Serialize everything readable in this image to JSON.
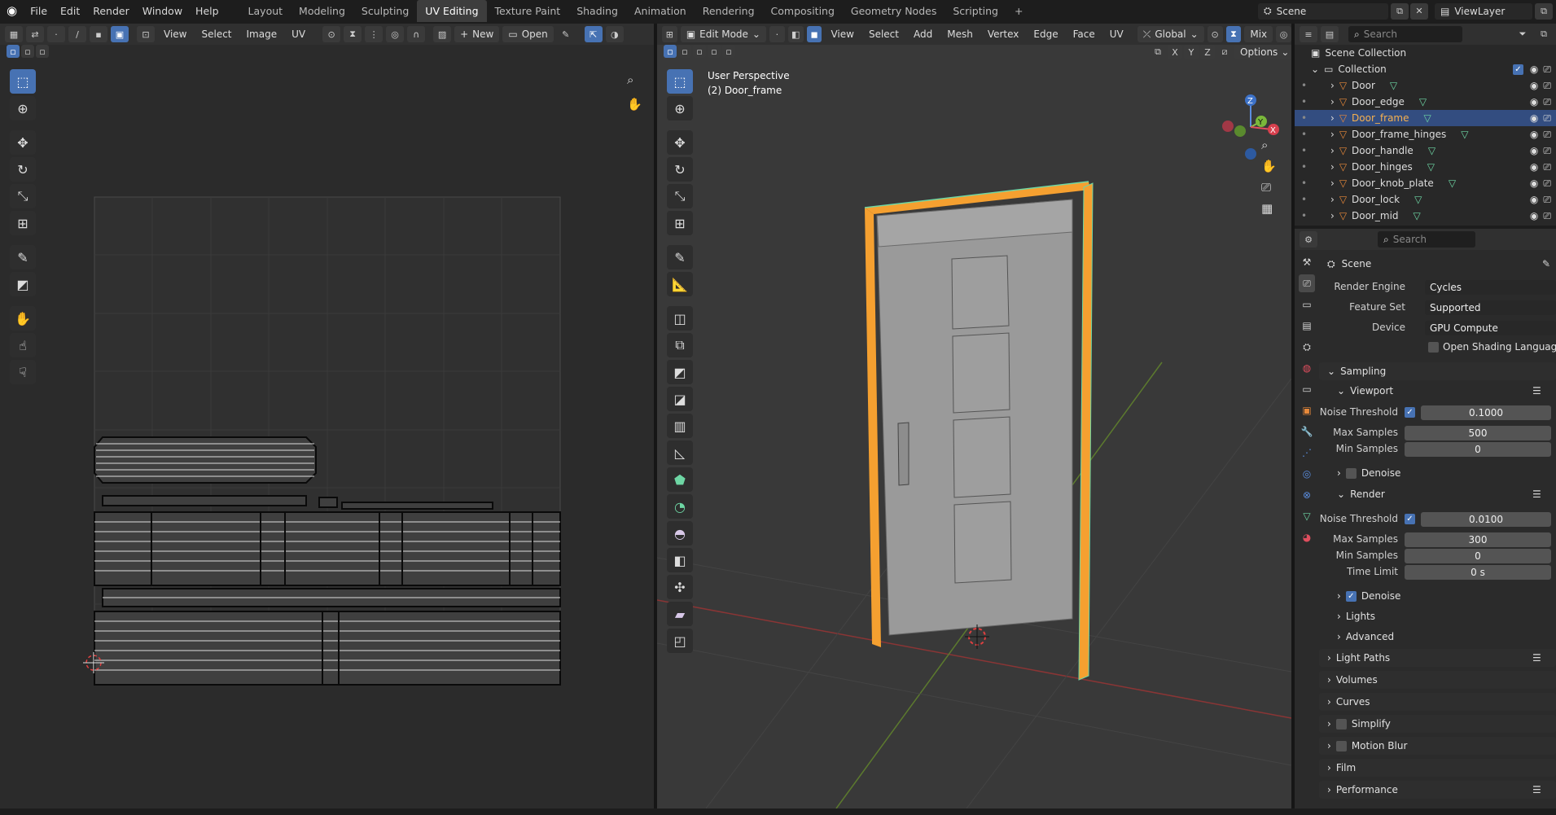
{
  "topbar": {
    "menus": [
      "File",
      "Edit",
      "Render",
      "Window",
      "Help"
    ],
    "tabs": [
      "Layout",
      "Modeling",
      "Sculpting",
      "UV Editing",
      "Texture Paint",
      "Shading",
      "Animation",
      "Rendering",
      "Compositing",
      "Geometry Nodes",
      "Scripting"
    ],
    "active_tab": "UV Editing",
    "add_tab": "+",
    "scene": "Scene",
    "view_layer": "ViewLayer"
  },
  "uv_editor": {
    "menus": [
      "View",
      "Select",
      "Image",
      "UV"
    ],
    "new_label": "New",
    "open_label": "Open"
  },
  "viewport": {
    "mode": "Edit Mode",
    "menus": [
      "View",
      "Select",
      "Add",
      "Mesh",
      "Vertex",
      "Edge",
      "Face",
      "UV"
    ],
    "orientation": "Global",
    "shading": "Mix",
    "axes": [
      "X",
      "Y",
      "Z"
    ],
    "options_label": "Options",
    "overlay_title": "User Perspective",
    "overlay_object": "(2) Door_frame",
    "gizmo": {
      "z": "Z",
      "y": "Y",
      "x": "X"
    }
  },
  "outliner": {
    "search_placeholder": "Search",
    "root": "Scene Collection",
    "collection": "Collection",
    "items": [
      "Door",
      "Door_edge",
      "Door_frame",
      "Door_frame_hinges",
      "Door_handle",
      "Door_hinges",
      "Door_knob_plate",
      "Door_lock",
      "Door_mid"
    ],
    "selected": "Door_frame"
  },
  "properties": {
    "search_placeholder": "Search",
    "context": "Scene",
    "render_engine_label": "Render Engine",
    "render_engine": "Cycles",
    "feature_set_label": "Feature Set",
    "feature_set": "Supported",
    "device_label": "Device",
    "device": "GPU Compute",
    "osl_label": "Open Shading Language",
    "sampling": "Sampling",
    "viewport": "Viewport",
    "noise_threshold_label": "Noise Threshold",
    "vp_noise_threshold": "0.1000",
    "max_samples_label": "Max Samples",
    "vp_max_samples": "500",
    "min_samples_label": "Min Samples",
    "vp_min_samples": "0",
    "denoise_label": "Denoise",
    "render": "Render",
    "r_noise_threshold": "0.0100",
    "r_max_samples": "300",
    "r_min_samples": "0",
    "time_limit_label": "Time Limit",
    "r_time_limit": "0 s",
    "lights": "Lights",
    "advanced": "Advanced",
    "light_paths": "Light Paths",
    "volumes": "Volumes",
    "curves": "Curves",
    "simplify": "Simplify",
    "motion_blur": "Motion Blur",
    "film": "Film",
    "performance": "Performance"
  },
  "colors": {
    "accent": "#4772b3",
    "selection_orange": "#f5a030",
    "object_orange": "#e8893a",
    "mesh_green": "#6ed6a4"
  }
}
